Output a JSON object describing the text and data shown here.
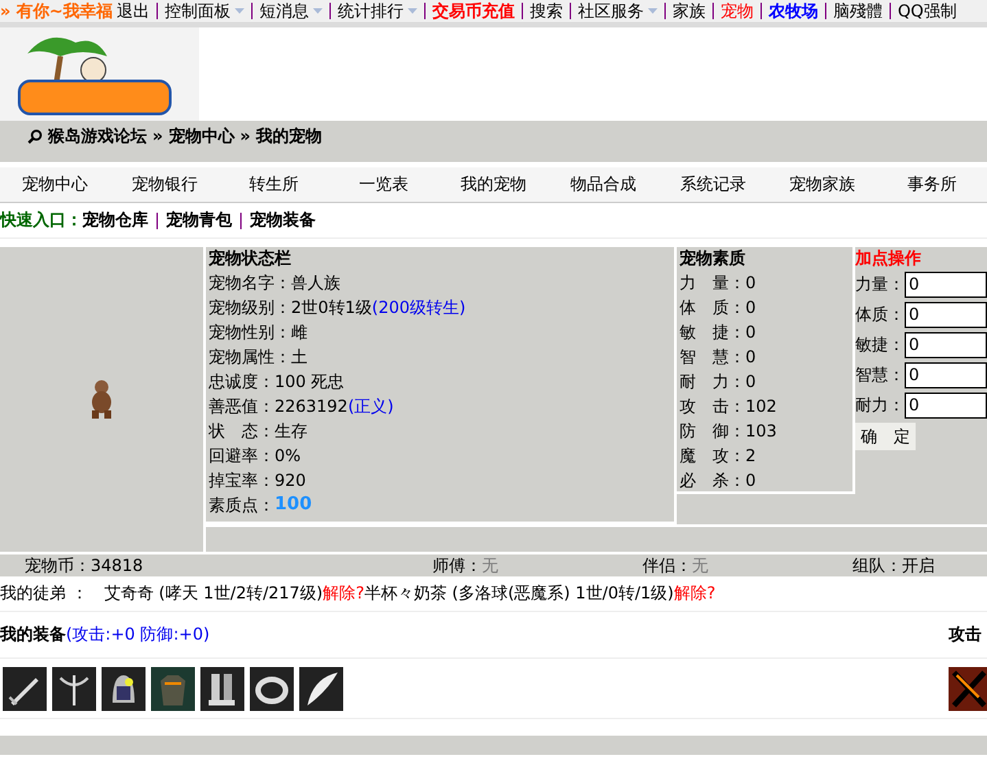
{
  "top_nav": [
    {
      "label": "» 有你~我幸福",
      "kind": "greeting",
      "dropdown": false
    },
    {
      "label": "退出",
      "kind": "plain",
      "dropdown": false
    },
    {
      "label": "控制面板",
      "kind": "plain",
      "dropdown": true
    },
    {
      "label": "短消息",
      "kind": "plain",
      "dropdown": true
    },
    {
      "label": "统计排行",
      "kind": "plain",
      "dropdown": true
    },
    {
      "label": "交易币充值",
      "kind": "red-bold",
      "dropdown": false
    },
    {
      "label": "搜索",
      "kind": "plain",
      "dropdown": false
    },
    {
      "label": "社区服务",
      "kind": "plain",
      "dropdown": true
    },
    {
      "label": "家族",
      "kind": "plain",
      "dropdown": false
    },
    {
      "label": "宠物",
      "kind": "red",
      "dropdown": false
    },
    {
      "label": "农牧场",
      "kind": "blue-bold",
      "dropdown": false
    },
    {
      "label": "脑殘體",
      "kind": "plain",
      "dropdown": false
    },
    {
      "label": "QQ强制",
      "kind": "plain",
      "dropdown": false
    }
  ],
  "breadcrumb": {
    "separator": "»",
    "items": [
      "猴岛游戏论坛",
      "宠物中心",
      "我的宠物"
    ]
  },
  "tabs": [
    {
      "label": "宠物中心",
      "selected": false
    },
    {
      "label": "宠物银行",
      "selected": false
    },
    {
      "label": "转生所",
      "selected": false
    },
    {
      "label": "一览表",
      "selected": false
    },
    {
      "label": "我的宠物",
      "selected": false
    },
    {
      "label": "物品合成",
      "selected": false
    },
    {
      "label": "系统记录",
      "selected": false
    },
    {
      "label": "宠物家族",
      "selected": false
    },
    {
      "label": "事务所",
      "selected": false
    }
  ],
  "quick_entry": {
    "label": "快速入口：",
    "links": [
      "宠物仓库",
      "宠物青包",
      "宠物装备"
    ]
  },
  "status_panel": {
    "title": "宠物状态栏",
    "rows": [
      {
        "label": "宠物名字：",
        "value": "兽人族",
        "kind": "plain"
      },
      {
        "label": "宠物级别：",
        "value": "2世0转1级",
        "link": "(200级转生)",
        "kind": "link"
      },
      {
        "label": "宠物性别：",
        "value": "雌",
        "kind": "plain"
      },
      {
        "label": "宠物属性：",
        "value": "土",
        "kind": "plain"
      },
      {
        "label": "忠诚度：",
        "value": "100 死忠",
        "kind": "plain"
      },
      {
        "label": "善恶值：",
        "value": "2263192",
        "link": "(正义)",
        "kind": "link"
      },
      {
        "label": "状　态：",
        "value": "生存",
        "kind": "plain"
      },
      {
        "label": "回避率：",
        "value": "0%",
        "kind": "plain"
      },
      {
        "label": "掉宝率：",
        "value": "920",
        "kind": "plain"
      },
      {
        "label": "素质点：",
        "value": "100",
        "kind": "highlight"
      }
    ]
  },
  "attributes": {
    "title": "宠物素质",
    "rows": [
      {
        "label": "力　量：",
        "value": "0"
      },
      {
        "label": "体　质：",
        "value": "0"
      },
      {
        "label": "敏　捷：",
        "value": "0"
      },
      {
        "label": "智　慧：",
        "value": "0"
      },
      {
        "label": "耐　力：",
        "value": "0"
      },
      {
        "label": "攻　击：",
        "value": "102"
      },
      {
        "label": "防　御：",
        "value": "103"
      },
      {
        "label": "魔　攻：",
        "value": "2"
      },
      {
        "label": "必　杀：",
        "value": "0"
      }
    ]
  },
  "add_points": {
    "title": "加点操作",
    "fields": [
      {
        "label": "力量：",
        "value": "0"
      },
      {
        "label": "体质：",
        "value": "0"
      },
      {
        "label": "敏捷：",
        "value": "0"
      },
      {
        "label": "智慧：",
        "value": "0"
      },
      {
        "label": "耐力：",
        "value": "0"
      }
    ],
    "button": "确　定"
  },
  "info_bar": [
    {
      "label": "宠物币：",
      "value": "34818",
      "dim": false
    },
    {
      "label": "师傅：",
      "value": "无",
      "dim": true
    },
    {
      "label": "伴侣：",
      "value": "无",
      "dim": true
    },
    {
      "label": "组队：",
      "value": " 开启",
      "dim": false
    }
  ],
  "disciples": {
    "label": "我的徒弟 ：",
    "items": [
      {
        "text": "艾奇奇 (哮天 1世/2转/217级)",
        "action": "解除?"
      },
      {
        "text": "半杯々奶茶 (多洛球(恶魔系) 1世/0转/1级)",
        "action": "解除?"
      }
    ]
  },
  "equipment": {
    "title": "我的装备",
    "stats": "(攻击:+0 防御:+0)",
    "right_label": "攻击",
    "items": [
      {
        "kind": "sword"
      },
      {
        "kind": "crossbow"
      },
      {
        "kind": "helmet"
      },
      {
        "kind": "armor"
      },
      {
        "kind": "boots"
      },
      {
        "kind": "ring"
      },
      {
        "kind": "wing"
      }
    ]
  }
}
